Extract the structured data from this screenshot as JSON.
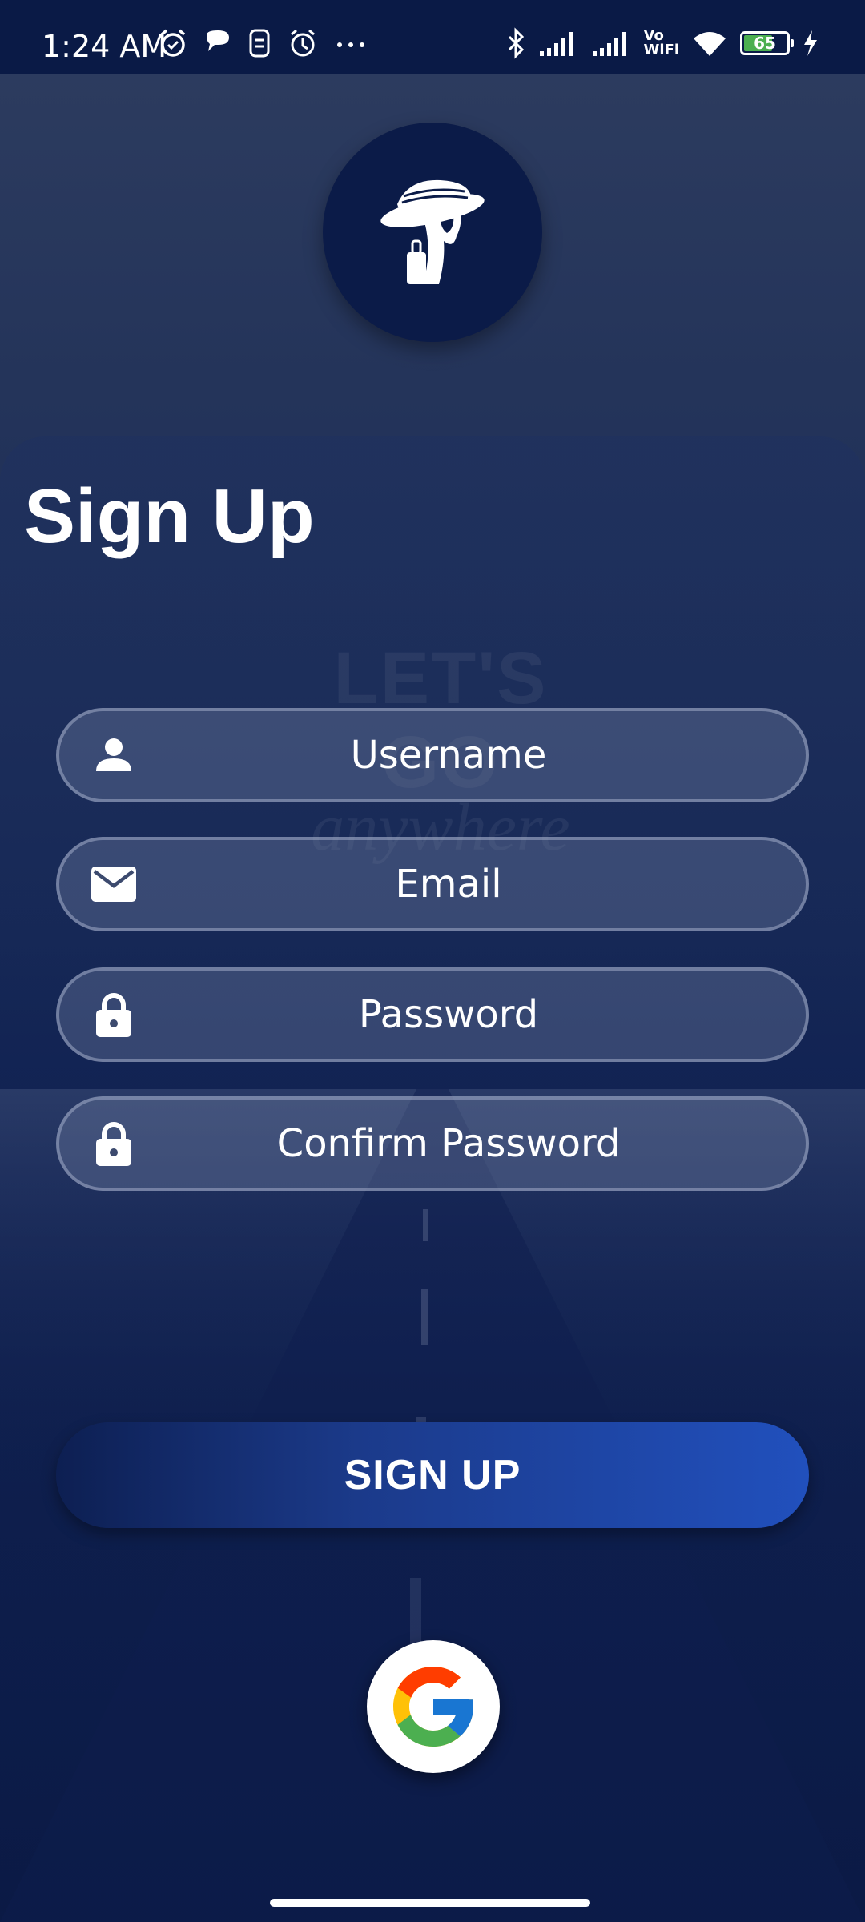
{
  "status_bar": {
    "time": "1:24 AM",
    "battery_level": "65",
    "left_icons": [
      "alarm-clock-icon",
      "chat-bubble-icon",
      "sim-icon",
      "alarm-icon",
      "more-dots-icon"
    ],
    "right_icons": [
      "bluetooth-icon",
      "signal-icon",
      "signal-icon",
      "vowifi-icon",
      "wifi-icon",
      "battery-icon",
      "charging-icon"
    ],
    "vowifi_label_top": "Vo",
    "vowifi_label_bottom": "WiFi"
  },
  "header": {
    "logo": "traveler-hat-suitcase-logo"
  },
  "form": {
    "title": "Sign Up",
    "username_placeholder": "Username",
    "email_placeholder": "Email",
    "password_placeholder": "Password",
    "confirm_password_placeholder": "Confirm Password",
    "submit_label": "SIGN UP"
  },
  "social": {
    "google_icon": "google-icon"
  },
  "colors": {
    "background": "#0b1a45",
    "button_gradient_end": "#2150bd",
    "field_fill": "#3c4a6e"
  }
}
